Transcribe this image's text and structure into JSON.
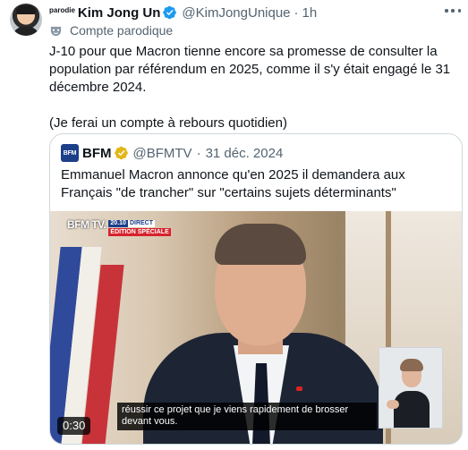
{
  "tweet": {
    "parody_tag": "parodie",
    "display_name": "Kim Jong Un",
    "handle": "@KimJongUnique",
    "separator": "·",
    "time": "1h",
    "parody_label": "Compte parodique",
    "text_line1": "J-10 pour que Macron tienne encore sa promesse de consulter la population par référendum en 2025, comme il s'y était engagé le 31 décembre 2024.",
    "text_line2": "(Je ferai un compte à rebours quotidien)",
    "colors": {
      "verified": "#1d9bf0",
      "gold": "#e2b719",
      "muted": "#536471"
    }
  },
  "quote": {
    "logo_text": "BFM",
    "display_name": "BFM",
    "handle": "@BFMTV",
    "separator": "·",
    "date": "31 déc. 2024",
    "text": "Emmanuel Macron annonce qu'en 2025 il demandera aux Français \"de trancher\" sur \"certains sujets déterminants\"",
    "media": {
      "channel_logo": "BFM TV.",
      "channel_time": "20.10",
      "channel_live": "DIRECT",
      "channel_banner": "ÉDITION SPÉCIALE",
      "subtitle": "réussir ce projet que je viens rapidement de brosser devant vous.",
      "duration": "0:30"
    }
  },
  "icons": {
    "verified": "verified-badge-icon",
    "gold": "gold-verified-badge-icon",
    "more": "more-dots-icon",
    "mask": "parody-mask-icon"
  }
}
